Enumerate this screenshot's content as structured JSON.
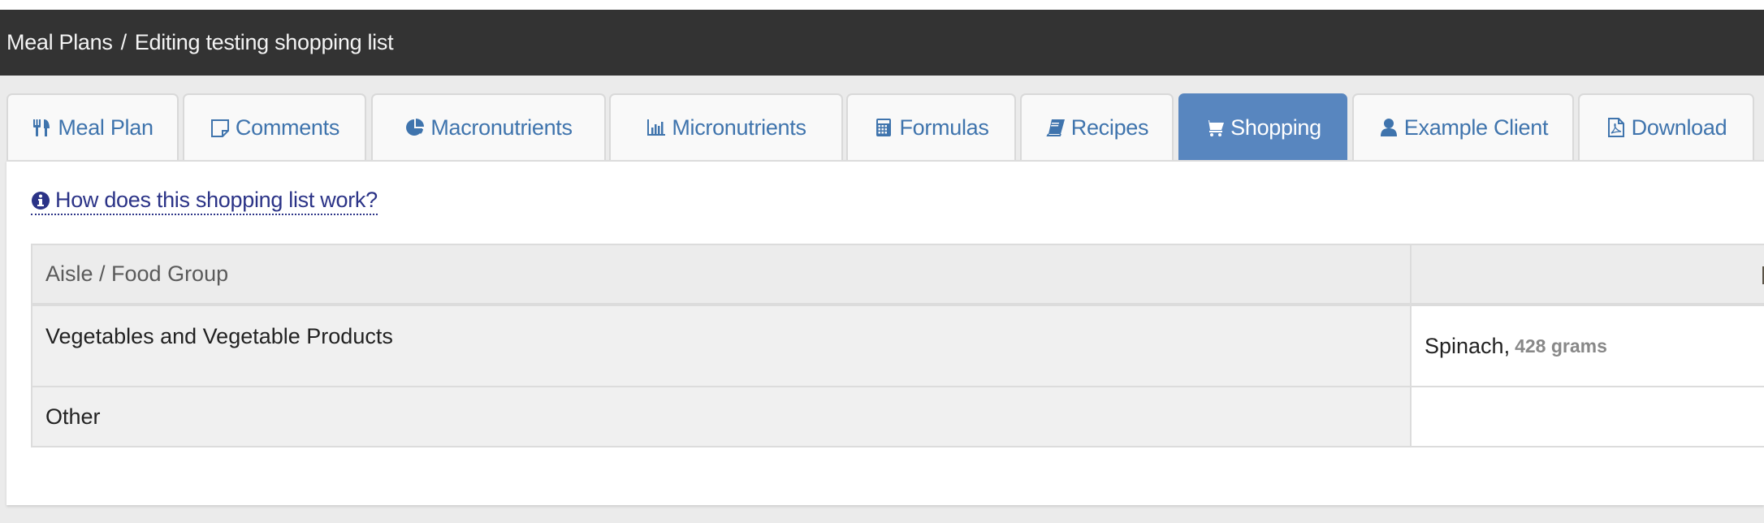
{
  "breadcrumb": {
    "root": "Meal Plans",
    "separator": "/",
    "current": "Editing testing shopping list"
  },
  "tabs": [
    {
      "label": "Meal Plan",
      "icon": "utensils-icon",
      "active": false
    },
    {
      "label": "Comments",
      "icon": "sticky-note-icon",
      "active": false
    },
    {
      "label": "Macronutrients",
      "icon": "pie-chart-icon",
      "active": false
    },
    {
      "label": "Micronutrients",
      "icon": "bar-chart-icon",
      "active": false
    },
    {
      "label": "Formulas",
      "icon": "calculator-icon",
      "active": false
    },
    {
      "label": "Recipes",
      "icon": "book-icon",
      "active": false
    },
    {
      "label": "Shopping",
      "icon": "shopping-cart-icon",
      "active": true
    },
    {
      "label": "Example Client",
      "icon": "user-icon",
      "active": false
    },
    {
      "label": "Download",
      "icon": "pdf-file-icon",
      "active": false
    }
  ],
  "help_link": {
    "label": "How does this shopping list work?",
    "icon": "info-circle-icon"
  },
  "table": {
    "columns": [
      "Aisle / Food Group",
      ""
    ],
    "rows": [
      {
        "group": "Vegetables and Vegetable Products",
        "item": "Spinach,",
        "quantity": "428 grams"
      },
      {
        "group": "Other",
        "item": "",
        "quantity": ""
      }
    ]
  },
  "colors": {
    "topbar": "#333333",
    "tab_text": "#3f74ad",
    "active_tab": "#5886bf",
    "link": "#2b3387"
  }
}
